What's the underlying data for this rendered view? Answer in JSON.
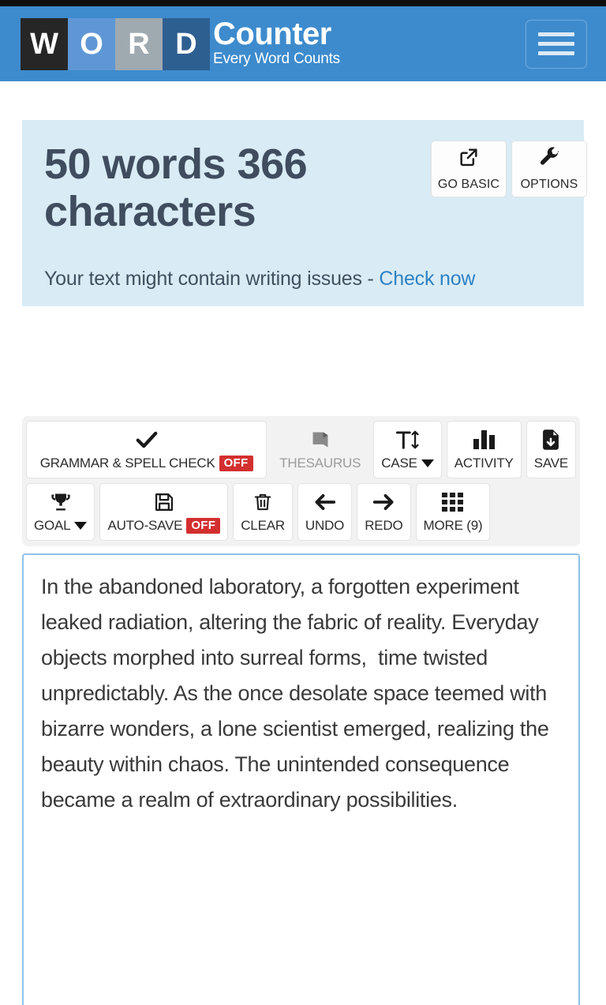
{
  "header": {
    "logo_tiles": [
      "W",
      "O",
      "R",
      "D"
    ],
    "brand_name": "Counter",
    "tagline": "Every Word Counts",
    "menu_icon": "hamburger-menu-icon"
  },
  "stats_card": {
    "headline": "50 words 366 characters",
    "word_count": 50,
    "character_count": 366,
    "buttons": [
      {
        "label": "GO BASIC",
        "icon": "external-link-icon"
      },
      {
        "label": "OPTIONS",
        "icon": "wrench-icon"
      }
    ],
    "issues_text": "Your text might contain writing issues - ",
    "issues_link": "Check now"
  },
  "toolbar": {
    "row1": [
      {
        "label": "GRAMMAR & SPELL CHECK",
        "icon": "checkmark-icon",
        "badge": "OFF",
        "state": "enabled",
        "dropdown": false
      },
      {
        "label": "THESAURUS",
        "icon": "book-icon",
        "badge": null,
        "state": "disabled",
        "dropdown": false
      },
      {
        "label": "CASE",
        "icon": "text-case-icon",
        "badge": null,
        "state": "enabled",
        "dropdown": true
      },
      {
        "label": "ACTIVITY",
        "icon": "bar-chart-icon",
        "badge": null,
        "state": "enabled",
        "dropdown": false
      },
      {
        "label": "SAVE",
        "icon": "file-download-icon",
        "badge": null,
        "state": "enabled",
        "dropdown": false
      }
    ],
    "row2": [
      {
        "label": "GOAL",
        "icon": "trophy-icon",
        "badge": null,
        "state": "enabled",
        "dropdown": true
      },
      {
        "label": "AUTO-SAVE",
        "icon": "floppy-disk-icon",
        "badge": "OFF",
        "state": "enabled",
        "dropdown": false
      },
      {
        "label": "CLEAR",
        "icon": "trash-icon",
        "badge": null,
        "state": "enabled",
        "dropdown": false
      },
      {
        "label": "UNDO",
        "icon": "arrow-left-icon",
        "badge": null,
        "state": "enabled",
        "dropdown": false
      },
      {
        "label": "REDO",
        "icon": "arrow-right-icon",
        "badge": null,
        "state": "enabled",
        "dropdown": false
      },
      {
        "label": "MORE (9)",
        "icon": "grid-icon",
        "badge": null,
        "state": "enabled",
        "dropdown": false
      }
    ]
  },
  "editor": {
    "text": "In the abandoned laboratory, a forgotten experiment leaked radiation, altering the fabric of reality. Everyday objects morphed into surreal forms,  time twisted unpredictably. As the once desolate space teemed with bizarre wonders, a lone scientist emerged, realizing the beauty within chaos. The unintended consequence became a realm of extraordinary possibilities.",
    "placeholder": ""
  },
  "colors": {
    "header_blue": "#3d8bcd",
    "card_blue": "#d9ecf5",
    "headline_slate": "#3f4d5e",
    "link_blue": "#2f81c4",
    "badge_red": "#d32f2f",
    "toolbar_gray": "#f2f2f2",
    "editor_border": "#8fc1e8"
  }
}
